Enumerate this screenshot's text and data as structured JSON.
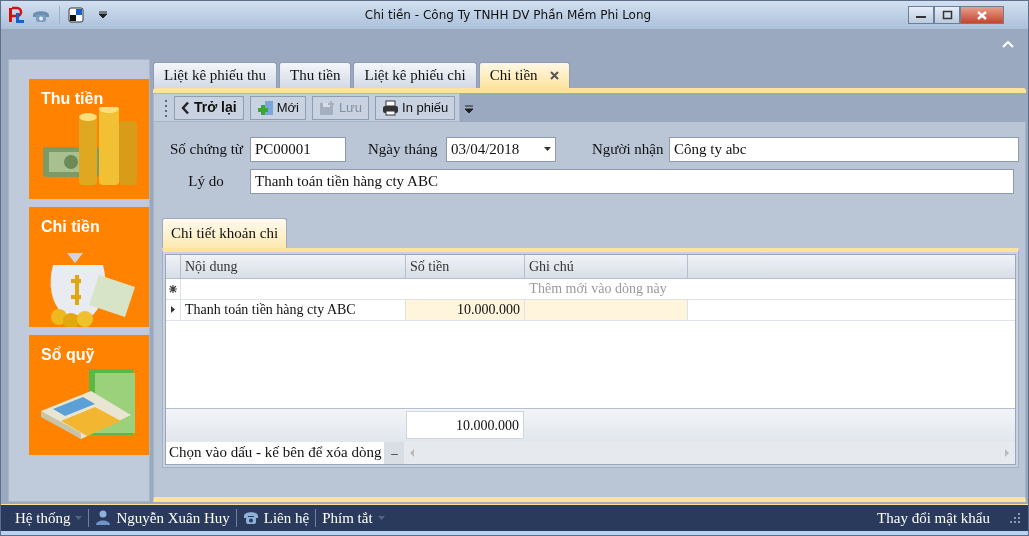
{
  "window": {
    "title": "Chi tiền - Công Ty TNHH DV Phần Mềm Phi Long"
  },
  "sidebar": {
    "items": [
      {
        "label": "Thu tiền",
        "kind": "coins"
      },
      {
        "label": "Chi tiền",
        "kind": "moneybag"
      },
      {
        "label": "Sổ quỹ",
        "kind": "calculator"
      }
    ]
  },
  "tabs": [
    {
      "label": "Liệt kê phiếu thu",
      "selected": false,
      "closable": false
    },
    {
      "label": "Thu tiền",
      "selected": false,
      "closable": false
    },
    {
      "label": "Liệt kê phiếu chi",
      "selected": false,
      "closable": false
    },
    {
      "label": "Chi tiền",
      "selected": true,
      "closable": true
    }
  ],
  "toolbar": {
    "buttons": [
      {
        "label": "Trở lại",
        "kind": "back",
        "disabled": false
      },
      {
        "label": "Mới",
        "kind": "new",
        "disabled": false
      },
      {
        "label": "Lưu",
        "kind": "save",
        "disabled": true
      },
      {
        "label": "In phiếu",
        "kind": "print",
        "disabled": false
      }
    ]
  },
  "form": {
    "voucher_no": {
      "label": "Số chứng từ",
      "value": "PC00001"
    },
    "date": {
      "label": "Ngày tháng",
      "value": "03/04/2018"
    },
    "recipient": {
      "label": "Người nhận",
      "value": "Công ty abc"
    },
    "reason": {
      "label": "Lý do",
      "value": "Thanh toán tiền hàng cty ABC"
    }
  },
  "detail_tabs": [
    {
      "label": "Chi tiết khoản chi",
      "selected": true
    }
  ],
  "grid": {
    "columns": [
      "Nội dung",
      "Số tiền",
      "Ghi chú"
    ],
    "new_row_hint": "Thêm mới vào dòng này",
    "rows": [
      {
        "content": "Thanh toán tiền hàng cty ABC",
        "amount": "10.000.000",
        "current": true
      }
    ],
    "total": "10.000.000",
    "delete_hint": "Chọn vào dấu - kế bên để xóa dòng",
    "delete_button": "–"
  },
  "status_bar": {
    "items": [
      {
        "label": "Hệ thống",
        "kind": "menu"
      },
      {
        "label": "Nguyễn Xuân Huy",
        "kind": "user"
      },
      {
        "label": "Liên hệ",
        "kind": "phone"
      },
      {
        "label": "Phím tắt",
        "kind": "menu"
      }
    ],
    "right": "Thay đổi mật khẩu"
  }
}
